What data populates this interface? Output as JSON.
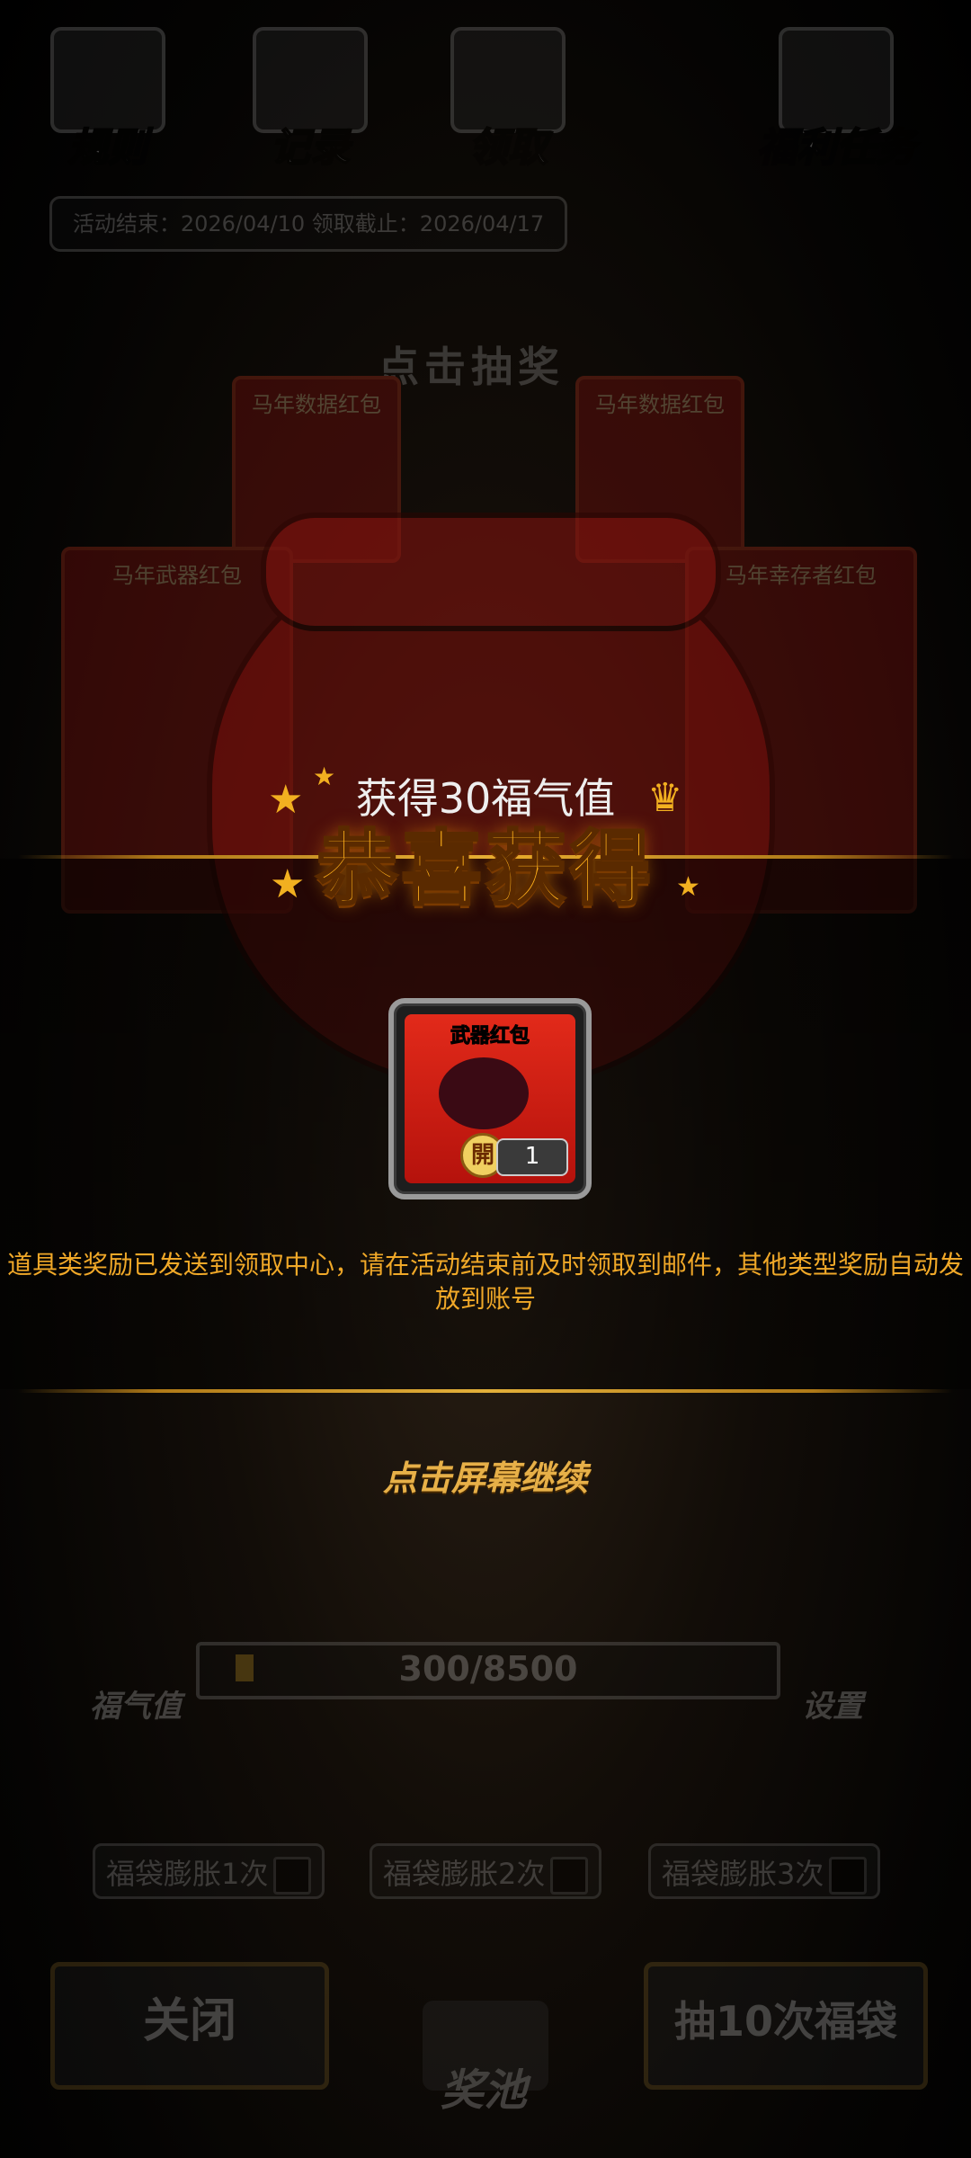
{
  "top_nav": {
    "rules_label": "规则",
    "records_label": "记录",
    "claim_label": "领取",
    "welfare_label": "福利任务"
  },
  "event_dates": "活动结束：2026/04/10  领取截止：2026/04/17",
  "draw_title": "点击抽奖",
  "cards": {
    "weapon": "马年武器红包",
    "survivor": "马年幸存者红包",
    "back_left": "马年数据红包",
    "back_right": "马年数据红包",
    "seal": "開"
  },
  "meter": {
    "label": "福气值",
    "value": "300/8500",
    "progress": 0.035
  },
  "settings_label": "设置",
  "expand_buttons": [
    "福袋膨胀1次",
    "福袋膨胀2次",
    "福袋膨胀3次"
  ],
  "bottom": {
    "close_label": "关闭",
    "pool_label": "奖池",
    "draw10_label": "抽10次福袋"
  },
  "reward": {
    "subtitle": "获得30福气值",
    "title": "恭喜获得",
    "item_name": "武器红包",
    "item_seal": "開",
    "item_count": "1",
    "notice": "道具类奖励已发送到领取中心，请在活动结束前及时领取到邮件，其他类型奖励自动发放到账号",
    "continue_hint": "点击屏幕继续"
  },
  "colors": {
    "accent_gold": "#ffb01a",
    "notice_orange": "#f0a828",
    "envelope_red": "#d11a10"
  }
}
